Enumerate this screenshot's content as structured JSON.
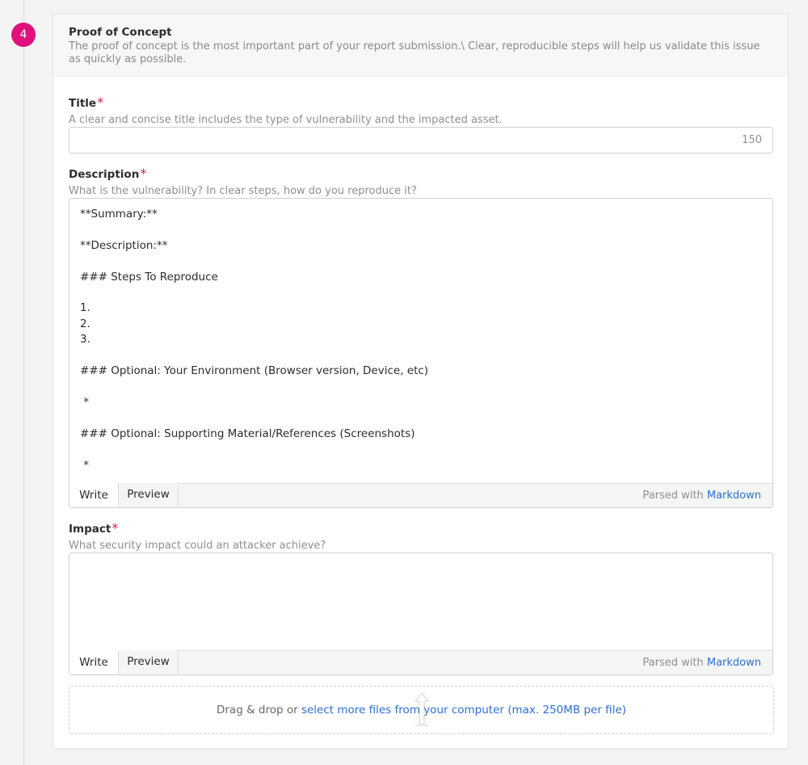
{
  "step": {
    "number": "4"
  },
  "section": {
    "title": "Proof of Concept",
    "description": "The proof of concept is the most important part of your report submission.\\ Clear, reproducible steps will help us validate this issue as quickly as possible."
  },
  "title_field": {
    "label": "Title",
    "required_mark": "*",
    "help": "A clear and concise title includes the type of vulnerability and the impacted asset.",
    "value": "",
    "char_count": "150"
  },
  "description_field": {
    "label": "Description",
    "required_mark": "*",
    "help": "What is the vulnerability? In clear steps, how do you reproduce it?",
    "value": "**Summary:**\n\n**Description:**\n\n### Steps To Reproduce\n\n1.\n2.\n3.\n\n### Optional: Your Environment (Browser version, Device, etc)\n\n *\n\n### Optional: Supporting Material/References (Screenshots)\n\n *",
    "tab_write": "Write",
    "tab_preview": "Preview",
    "parsed_prefix": "Parsed with",
    "parsed_link": "Markdown"
  },
  "impact_field": {
    "label": "Impact",
    "required_mark": "*",
    "help": "What security impact could an attacker achieve?",
    "value": "",
    "tab_write": "Write",
    "tab_preview": "Preview",
    "parsed_prefix": "Parsed with",
    "parsed_link": "Markdown"
  },
  "dropzone": {
    "prefix": "Drag & drop or",
    "link": "select more files from your computer (max. 250MB per file)",
    "icon": "upload-icon"
  },
  "colors": {
    "accent_pink": "#e0107e",
    "link_blue": "#2e6fd0",
    "required_red": "#d21a5a"
  }
}
